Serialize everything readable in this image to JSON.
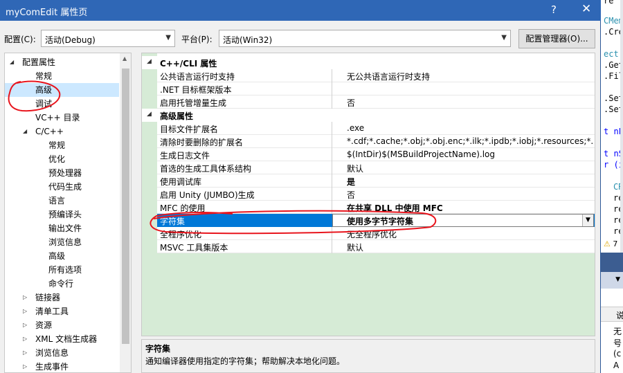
{
  "window": {
    "title": "myComEdit 属性页",
    "help_glyph": "?",
    "close_glyph": "✕"
  },
  "config_bar": {
    "config_label": "配置(C):",
    "config_value": "活动(Debug)",
    "platform_label": "平台(P):",
    "platform_value": "活动(Win32)",
    "manager_button": "配置管理器(O)..."
  },
  "tree": {
    "items": [
      {
        "label": "配置属性",
        "level": 0,
        "expander": "expanded"
      },
      {
        "label": "常规",
        "level": 1,
        "expander": "none"
      },
      {
        "label": "高级",
        "level": 1,
        "expander": "none",
        "selected": true
      },
      {
        "label": "调试",
        "level": 1,
        "expander": "none"
      },
      {
        "label": "VC++ 目录",
        "level": 1,
        "expander": "none"
      },
      {
        "label": "C/C++",
        "level": 1,
        "expander": "expanded"
      },
      {
        "label": "常规",
        "level": 2,
        "expander": "none"
      },
      {
        "label": "优化",
        "level": 2,
        "expander": "none"
      },
      {
        "label": "预处理器",
        "level": 2,
        "expander": "none"
      },
      {
        "label": "代码生成",
        "level": 2,
        "expander": "none"
      },
      {
        "label": "语言",
        "level": 2,
        "expander": "none"
      },
      {
        "label": "预编译头",
        "level": 2,
        "expander": "none"
      },
      {
        "label": "输出文件",
        "level": 2,
        "expander": "none"
      },
      {
        "label": "浏览信息",
        "level": 2,
        "expander": "none"
      },
      {
        "label": "高级",
        "level": 2,
        "expander": "none"
      },
      {
        "label": "所有选项",
        "level": 2,
        "expander": "none"
      },
      {
        "label": "命令行",
        "level": 2,
        "expander": "none"
      },
      {
        "label": "链接器",
        "level": 1,
        "expander": "collapsed"
      },
      {
        "label": "清单工具",
        "level": 1,
        "expander": "collapsed"
      },
      {
        "label": "资源",
        "level": 1,
        "expander": "collapsed"
      },
      {
        "label": "XML 文档生成器",
        "level": 1,
        "expander": "collapsed"
      },
      {
        "label": "浏览信息",
        "level": 1,
        "expander": "collapsed"
      },
      {
        "label": "生成事件",
        "level": 1,
        "expander": "collapsed"
      }
    ]
  },
  "grid": {
    "categories": [
      {
        "name": "C++/CLI 属性",
        "rows": [
          {
            "name": "公共语言运行时支持",
            "value": "无公共语言运行时支持",
            "bold": false
          },
          {
            "name": ".NET 目标框架版本",
            "value": "",
            "bold": false
          },
          {
            "name": "启用托管增量生成",
            "value": "否",
            "bold": false
          }
        ]
      },
      {
        "name": "高级属性",
        "rows": [
          {
            "name": "目标文件扩展名",
            "value": ".exe",
            "bold": false
          },
          {
            "name": "清除时要删除的扩展名",
            "value": "*.cdf;*.cache;*.obj;*.obj.enc;*.ilk;*.ipdb;*.iobj;*.resources;*.tlb;*.tli;*.t",
            "bold": false
          },
          {
            "name": "生成日志文件",
            "value": "$(IntDir)$(MSBuildProjectName).log",
            "bold": false
          },
          {
            "name": "首选的生成工具体系结构",
            "value": "默认",
            "bold": false
          },
          {
            "name": "使用调试库",
            "value": "是",
            "bold": true
          },
          {
            "name": "启用 Unity (JUMBO)生成",
            "value": "否",
            "bold": false
          },
          {
            "name": "MFC 的使用",
            "value": "在共享 DLL 中使用 MFC",
            "bold": true
          },
          {
            "name": "字符集",
            "value": "使用多字节字符集",
            "bold": true,
            "selected": true
          },
          {
            "name": "全程序优化",
            "value": "无全程序优化",
            "bold": false
          },
          {
            "name": "MSVC 工具集版本",
            "value": "默认",
            "bold": false
          }
        ]
      }
    ]
  },
  "description": {
    "title": "字符集",
    "text": "通知编译器使用指定的字符集；帮助解决本地化问题。"
  },
  "background_editor": {
    "lines": [
      "re",
      "CMem",
      ".Cre",
      "ect",
      ".Get",
      ".Fil",
      ".Set",
      ".Set",
      "t nL",
      "t nS",
      "r (i",
      "CR",
      "re",
      "re",
      "re",
      "re"
    ],
    "warning_count": "7",
    "output_header": "说",
    "output_lines": [
      "无",
      "号",
      "(c",
      "A"
    ]
  },
  "colors": {
    "titlebar": "#2f67b6",
    "grid_background": "#d6ebd6",
    "selection": "#0078d7",
    "tree_selection": "#cce8ff",
    "annotation": "#e8141c"
  }
}
